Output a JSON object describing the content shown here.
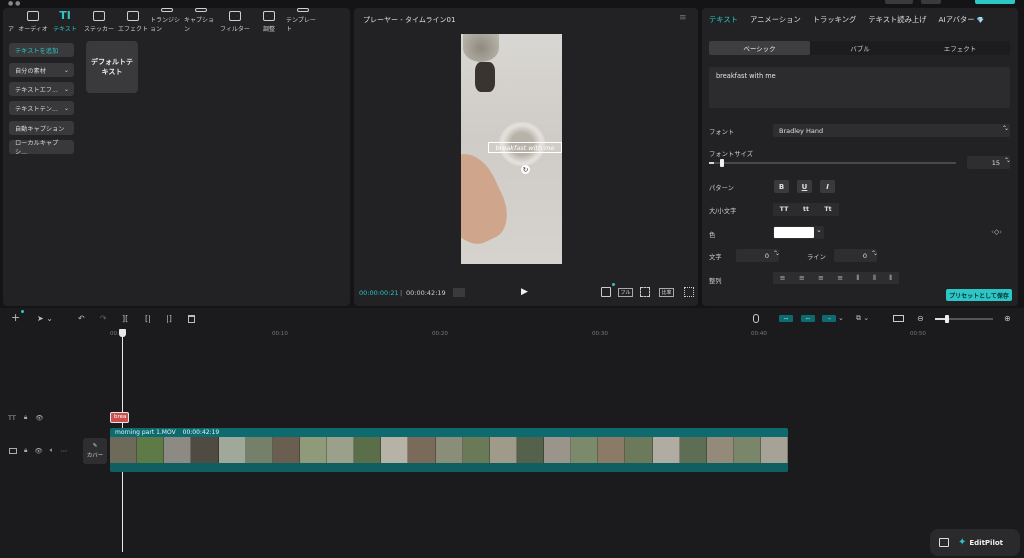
{
  "left_tabs": [
    {
      "label": "ア",
      "icon": "media-icon"
    },
    {
      "label": "オーディオ",
      "icon": "audio-icon"
    },
    {
      "label": "テキスト",
      "icon": "text-icon",
      "glyph": "TI",
      "active": true
    },
    {
      "label": "ステッカー",
      "icon": "sticker-icon"
    },
    {
      "label": "エフェクト",
      "icon": "effects-icon"
    },
    {
      "label": "トランジション",
      "icon": "transition-icon"
    },
    {
      "label": "キャプション",
      "icon": "caption-icon"
    },
    {
      "label": "フィルター",
      "icon": "filter-icon"
    },
    {
      "label": "調整",
      "icon": "adjust-icon"
    },
    {
      "label": "テンプレート",
      "icon": "template-icon"
    }
  ],
  "sidebar": {
    "items": [
      {
        "label": "テキストを追加",
        "active": true
      },
      {
        "label": "自分の素材",
        "chevron": "⌄"
      },
      {
        "label": "テキストエフ...",
        "chevron": "⌄"
      },
      {
        "label": "テキストテン...",
        "chevron": "⌄"
      },
      {
        "label": "自動キャプション"
      },
      {
        "label": "ローカルキャプシ..."
      }
    ]
  },
  "default_text_card": {
    "label": "デフォルトテキスト"
  },
  "player": {
    "title": "プレーヤー - タイムライン01",
    "menu_glyph": "≡",
    "current_time": "00:00:00:21",
    "total_time": "00:00:42:19",
    "play_glyph": "▶",
    "ratio_label": "比率",
    "full_label": "フル",
    "overlay_text": "breakfast with me",
    "rotate_glyph": "↻"
  },
  "right_tabs": [
    "テキスト",
    "アニメーション",
    "トラッキング",
    "テキスト読み上げ",
    "AIアバター"
  ],
  "ai_badge": "💎",
  "segments": [
    "ベーシック",
    "バブル",
    "エフェクト"
  ],
  "text_value": "breakfast with me",
  "props": {
    "font_label": "フォント",
    "font_value": "Bradley Hand",
    "size_label": "フォントサイズ",
    "size_value": "15",
    "size_fraction": 0.02,
    "pattern_label": "パターン",
    "pattern_buttons": [
      "B",
      "U",
      "I"
    ],
    "case_label": "大/小文字",
    "case_buttons": [
      "TT",
      "tt",
      "Tt"
    ],
    "color_label": "色",
    "color_value": "#ffffff",
    "char_label": "文字",
    "char_value": "0",
    "line_label": "ライン",
    "line_value": "0",
    "align_label": "整列",
    "preset_button": "プリセットとして保存",
    "chevron": "⌃⌄",
    "dropdown": "⌄",
    "keyframe_glyph": "◇"
  },
  "timeline": {
    "ticks": [
      "00:00",
      "00:10",
      "00:20",
      "00:30",
      "00:40",
      "00:50"
    ],
    "text_clip_label": "brea",
    "video_clip_name": "morning part 1.MOV",
    "video_clip_duration": "00:00:42:19",
    "cover_label": "カバー",
    "text_track_glyph": "TT"
  },
  "toolbar_glyphs": {
    "add": "+",
    "select": "⌅",
    "undo": "↶",
    "redo": "↷",
    "split": "][",
    "trim_left": "[|",
    "trim_right": "|]",
    "delete": "🗑",
    "mic": "🎙",
    "zoom_out": "⊖",
    "zoom_in": "⊕",
    "link1": "⊶",
    "link2": "⊷",
    "link3": "⊸"
  },
  "editpilot": {
    "label": "EditPilot"
  },
  "colors": {
    "accent": "#2cc6c6",
    "clip": "#0d6a6e",
    "text_clip": "#c9504f"
  }
}
